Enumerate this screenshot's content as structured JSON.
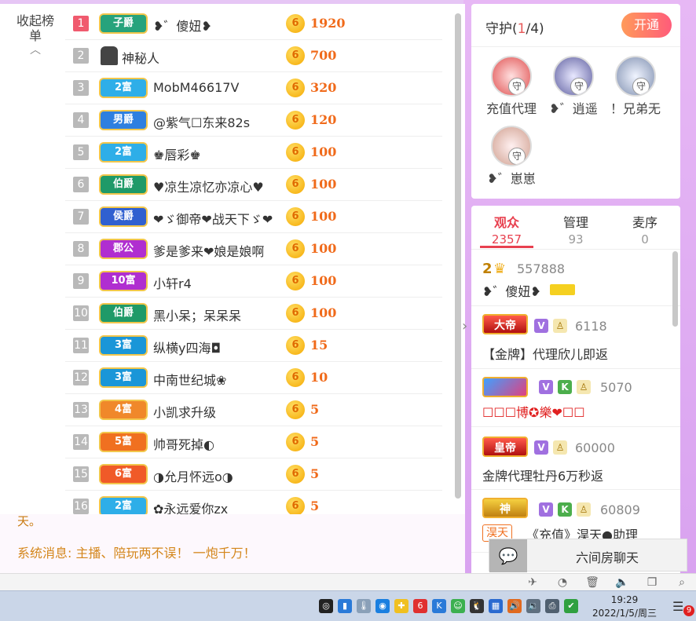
{
  "leaderboard": {
    "collapse_label": "收起榜单",
    "rows": [
      {
        "rank": "1",
        "badge": "子爵",
        "badge_color": "#27a37c",
        "name": "❥゛傻妞❥",
        "score": "1920"
      },
      {
        "rank": "2",
        "badge": "",
        "badge_color": "",
        "name": "神秘人",
        "score": "700"
      },
      {
        "rank": "3",
        "badge": "2富",
        "badge_color": "#2eaee8",
        "name": "MobM46617V",
        "score": "320"
      },
      {
        "rank": "4",
        "badge": "男爵",
        "badge_color": "#2e7fe0",
        "name": "@紫气☐东来82s",
        "score": "120"
      },
      {
        "rank": "5",
        "badge": "2富",
        "badge_color": "#2eaee8",
        "name": "♚唇彩♚",
        "score": "100"
      },
      {
        "rank": "6",
        "badge": "伯爵",
        "badge_color": "#1f9a68",
        "name": "♥凉生凉忆亦凉心♥",
        "score": "100"
      },
      {
        "rank": "7",
        "badge": "侯爵",
        "badge_color": "#3060d0",
        "name": "❤ゞ御帝❤战天下ゞ❤",
        "score": "100"
      },
      {
        "rank": "8",
        "badge": "郡公",
        "badge_color": "#b02ed0",
        "name": "爹是爹来❤娘是娘啊",
        "score": "100"
      },
      {
        "rank": "9",
        "badge": "10富",
        "badge_color": "#b02ed0",
        "name": "小轩r4",
        "score": "100"
      },
      {
        "rank": "10",
        "badge": "伯爵",
        "badge_color": "#1f9a68",
        "name": "黑小呆；呆呆呆",
        "score": "100"
      },
      {
        "rank": "11",
        "badge": "3富",
        "badge_color": "#1a96d8",
        "name": "纵横y四海◘",
        "score": "15"
      },
      {
        "rank": "12",
        "badge": "3富",
        "badge_color": "#1a96d8",
        "name": "中南世纪城❀",
        "score": "10"
      },
      {
        "rank": "13",
        "badge": "4富",
        "badge_color": "#f0882a",
        "name": "小凯求升级",
        "score": "5"
      },
      {
        "rank": "14",
        "badge": "5富",
        "badge_color": "#f07020",
        "name": "帅哥死掉◐",
        "score": "5"
      },
      {
        "rank": "15",
        "badge": "6富",
        "badge_color": "#f05a28",
        "name": "◑允月怀远ο◑",
        "score": "5"
      },
      {
        "rank": "16",
        "badge": "2富",
        "badge_color": "#2eaee8",
        "name": "✿永远爱你zx",
        "score": "5"
      }
    ]
  },
  "messages": {
    "cut_line": "天。",
    "system": "系统消息: 主播、陪玩两不误！ 一炮千万！"
  },
  "guard": {
    "title": "守护",
    "count_current": "1",
    "count_total": "/4",
    "open_label": "开通",
    "tag": "守",
    "members": [
      {
        "name": "充值代理"
      },
      {
        "name": "❥゛逍遥"
      },
      {
        "name": "！兄弟无"
      },
      {
        "name": "❥゛崽崽"
      }
    ]
  },
  "audience": {
    "tabs": [
      {
        "label": "观众",
        "count": "2357"
      },
      {
        "label": "管理",
        "count": "93"
      },
      {
        "label": "麦序",
        "count": "0"
      }
    ],
    "entries": [
      {
        "rank_icon": "2",
        "id": "557888",
        "line": "❥゛傻妞❥",
        "level": ""
      },
      {
        "rank_icon": "大帝",
        "id": "6118",
        "line": "【金牌】代理欣儿即返",
        "level": "大帝"
      },
      {
        "rank_icon": "",
        "id": "5070",
        "line": "☐☐☐博✪樂❤☐☐",
        "level": ""
      },
      {
        "rank_icon": "皇帝",
        "id": "60000",
        "line": "金牌代理牡丹6万秒返",
        "level": "皇帝"
      },
      {
        "rank_icon": "神",
        "id": "60809",
        "line": "《充值》淏天●助理",
        "level": "神",
        "tag": "淏天"
      }
    ]
  },
  "chat_button": {
    "label": "六间房聊天"
  },
  "clock": {
    "time": "19:29",
    "date": "2022/1/5/周三"
  },
  "notifications": {
    "count": "9"
  }
}
